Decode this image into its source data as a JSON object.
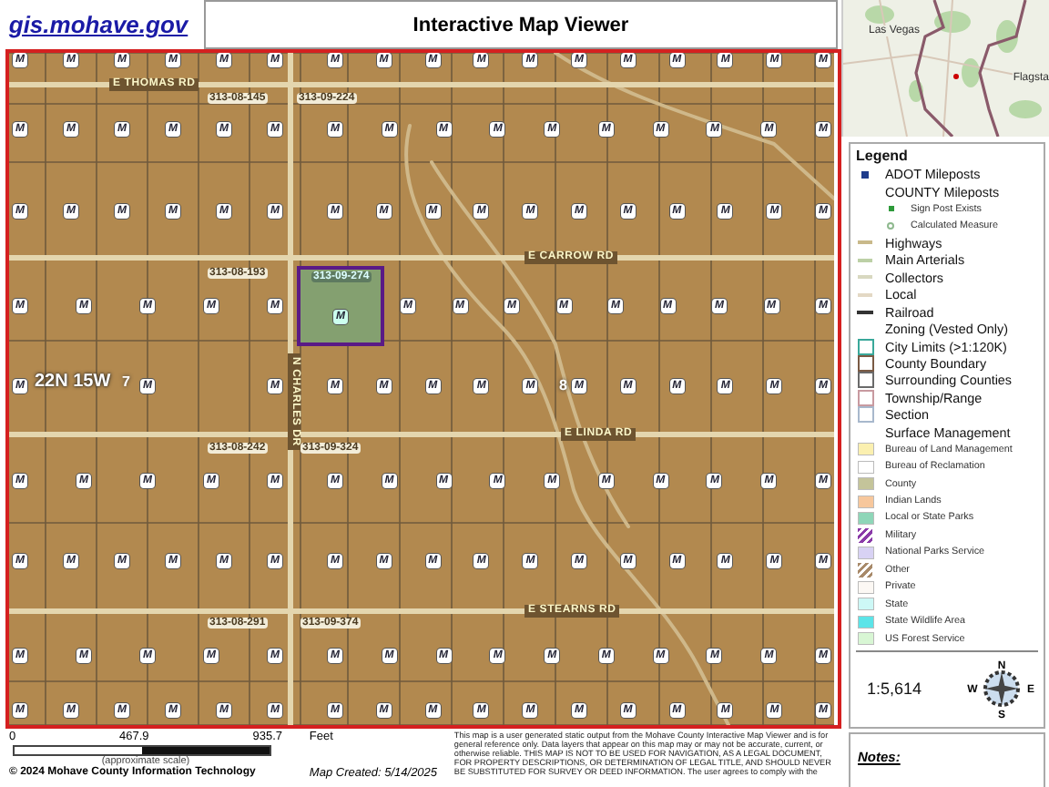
{
  "header": {
    "link": "gis.mohave.gov",
    "title": "Interactive Map Viewer"
  },
  "overview_map": {
    "places": [
      "Las Vegas",
      "Flagsta"
    ]
  },
  "map": {
    "roads": [
      {
        "kind": "horizontal",
        "label": "E THOMAS RD"
      },
      {
        "kind": "horizontal",
        "label": "E CARROW RD"
      },
      {
        "kind": "horizontal",
        "label": "E LINDA RD"
      },
      {
        "kind": "horizontal",
        "label": "E STEARNS RD"
      },
      {
        "kind": "vertical",
        "label": "N CHARLES DR"
      }
    ],
    "parcel_labels": [
      "313-08-145",
      "313-09-224",
      "313-08-193",
      "313-08-242",
      "313-09-324",
      "313-08-291",
      "313-09-374"
    ],
    "selected_parcel": {
      "label": "313-09-274",
      "marker": "M"
    },
    "township": "22N 15W",
    "sections": [
      "7",
      "8"
    ],
    "marker_rows": [
      {
        "left": [
          "M",
          "M",
          "M",
          "M",
          "M",
          "M"
        ],
        "right": [
          "M",
          "M",
          "M",
          "M",
          "M",
          "M",
          "M",
          "M",
          "M",
          "M",
          "M"
        ]
      },
      {
        "left": [
          "M",
          "M",
          "M",
          "M",
          "M",
          "M"
        ],
        "right": [
          "M",
          "M",
          "M",
          "M",
          "M",
          "M",
          "M",
          "M",
          "M",
          "M"
        ]
      },
      {
        "left": [
          "M",
          "M",
          "M",
          "M",
          "M",
          "M"
        ],
        "right": [
          "M",
          "M",
          "M",
          "M",
          "M",
          "M",
          "M",
          "M",
          "M",
          "M",
          "M"
        ]
      },
      {
        "left": [
          "M",
          "M",
          "M",
          "M",
          "M"
        ],
        "right": [
          "M",
          "M",
          "M",
          "M",
          "M",
          "M",
          "M",
          "M",
          "M"
        ]
      },
      {
        "left": [
          "M",
          "M",
          "M"
        ],
        "right": [
          "M",
          "M",
          "M",
          "M",
          "M",
          "M",
          "M",
          "M",
          "M",
          "M",
          "M"
        ]
      },
      {
        "left": [
          "M",
          "M",
          "M",
          "M",
          "M"
        ],
        "right": [
          "M",
          "M",
          "M",
          "M",
          "M",
          "M",
          "M",
          "M",
          "M",
          "M"
        ]
      },
      {
        "left": [
          "M",
          "M",
          "M",
          "M",
          "M",
          "M"
        ],
        "right": [
          "M",
          "M",
          "M",
          "M",
          "M",
          "M",
          "M",
          "M",
          "M",
          "M",
          "M"
        ]
      },
      {
        "left": [
          "M",
          "M",
          "M",
          "M",
          "M"
        ],
        "right": [
          "M",
          "M",
          "M",
          "M",
          "M",
          "M",
          "M",
          "M",
          "M",
          "M"
        ]
      },
      {
        "left": [
          "M",
          "M",
          "M",
          "M",
          "M",
          "M"
        ],
        "right": [
          "M",
          "M",
          "M",
          "M",
          "M",
          "M",
          "M",
          "M",
          "M",
          "M",
          "M"
        ]
      }
    ]
  },
  "legend": {
    "title": "Legend",
    "items": [
      {
        "kind": "point",
        "label": "ADOT Mileposts",
        "color": "#1f3c8c"
      },
      {
        "kind": "group",
        "label": "COUNTY Mileposts"
      },
      {
        "kind": "subpoint",
        "label": "Sign Post Exists",
        "color": "#2e9a3a"
      },
      {
        "kind": "subcross",
        "label": "Calculated Measure",
        "color": "#8fb98f"
      },
      {
        "kind": "line",
        "label": "Highways",
        "color": "#c9b98a"
      },
      {
        "kind": "line",
        "label": "Main Arterials",
        "color": "#bcd0a6"
      },
      {
        "kind": "line",
        "label": "Collectors",
        "color": "#d8d8c0"
      },
      {
        "kind": "line",
        "label": "Local",
        "color": "#e3d8c4"
      },
      {
        "kind": "rail",
        "label": "Railroad",
        "color": "#333333"
      },
      {
        "kind": "group",
        "label": "Zoning (Vested Only)"
      },
      {
        "kind": "outline",
        "label": "City Limits (>1:120K)",
        "color": "#3aa89a"
      },
      {
        "kind": "outline",
        "label": "County Boundary",
        "color": "#7a5a44"
      },
      {
        "kind": "outline",
        "label": "Surrounding Counties",
        "color": "#6a6a6a"
      },
      {
        "kind": "outline",
        "label": "Township/Range",
        "color": "#c89aa0"
      },
      {
        "kind": "outline",
        "label": "Section",
        "color": "#a8b8cc"
      },
      {
        "kind": "group",
        "label": "Surface Management"
      },
      {
        "kind": "swatch",
        "label": "Bureau of Land Management",
        "color": "#fbf0b0"
      },
      {
        "kind": "swatch",
        "label": "Bureau of Reclamation",
        "color": "#ffffff"
      },
      {
        "kind": "swatch",
        "label": "County",
        "color": "#c4c49a"
      },
      {
        "kind": "swatch",
        "label": "Indian Lands",
        "color": "#f7c79c"
      },
      {
        "kind": "swatch",
        "label": "Local or State Parks",
        "color": "#8ed6b8"
      },
      {
        "kind": "hatch",
        "label": "Military",
        "color": "#8a3aa8"
      },
      {
        "kind": "swatch",
        "label": "National Parks Service",
        "color": "#d8d2f4"
      },
      {
        "kind": "hatch",
        "label": "Other",
        "color": "#a88a6a"
      },
      {
        "kind": "swatch",
        "label": "Private",
        "color": "#fcf8f4"
      },
      {
        "kind": "swatch",
        "label": "State",
        "color": "#cdf8f6"
      },
      {
        "kind": "swatch",
        "label": "State Wildlife Area",
        "color": "#5ce4e8"
      },
      {
        "kind": "swatch",
        "label": "US Forest Service",
        "color": "#d8f6d4"
      }
    ]
  },
  "scale": "1:5,614",
  "compass": {
    "north": "N",
    "east": "E",
    "south": "S",
    "west": "W"
  },
  "notes": {
    "title": "Notes:"
  },
  "footer": {
    "ticks": [
      "0",
      "467.9",
      "935.7"
    ],
    "unit": "Feet",
    "scale_note": "(approximate scale)",
    "copyright": "© 2024 Mohave County Information Technology",
    "created": "Map Created: 5/14/2025",
    "disclaimer": "This map is a user generated static output from the Mohave County Interactive Map Viewer and is for general reference only. Data layers that appear on this map may or may not be accurate, current, or otherwise reliable. THIS MAP IS NOT TO BE USED FOR NAVIGATION, AS A LEGAL DOCUMENT, FOR PROPERTY DESCRIPTIONS, OR DETERMINATION OF LEGAL TITLE, AND SHOULD NEVER BE SUBSTITUTED FOR SURVEY OR DEED INFORMATION. The user agrees to comply with the"
  }
}
